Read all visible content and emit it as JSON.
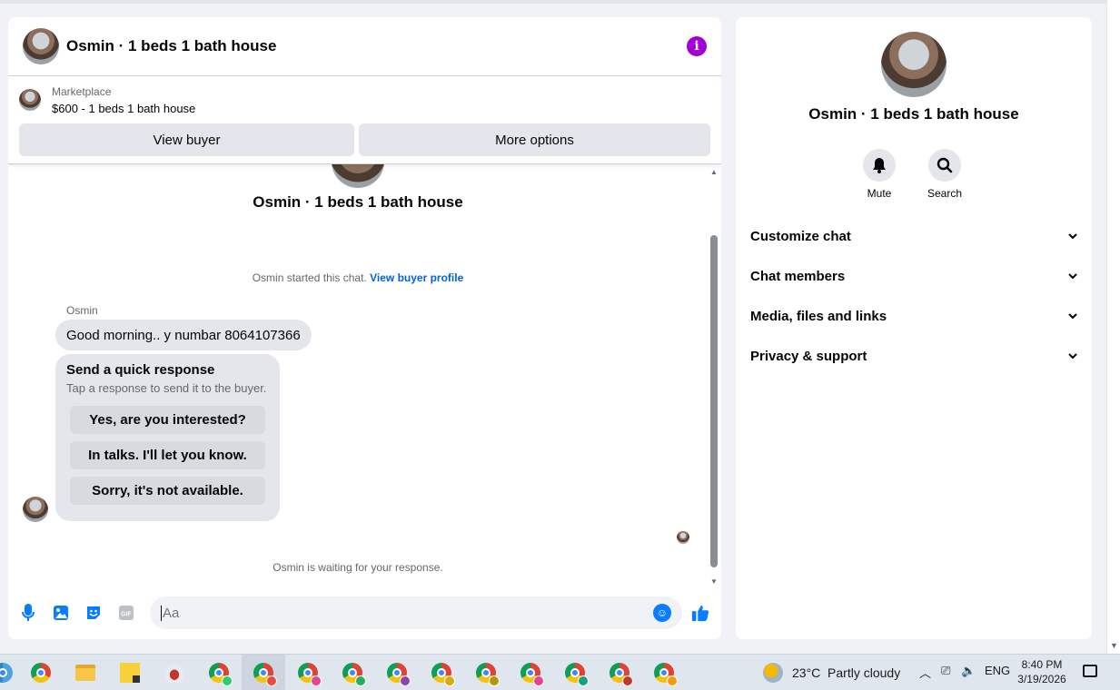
{
  "header": {
    "title": "Osmin · 1 beds 1 bath house",
    "info_icon": "info-icon"
  },
  "listing": {
    "label": "Marketplace",
    "price_title": "$600 - 1 beds 1 bath house",
    "view_buyer": "View buyer",
    "more_options": "More options"
  },
  "thread": {
    "title": "Osmin · 1 beds 1 bath house",
    "started_text": "Osmin started this chat.",
    "view_profile": "View buyer profile",
    "sender": "Osmin",
    "message": "Good morning.. y numbar 8064107366",
    "quick": {
      "title": "Send a quick response",
      "subtitle": "Tap a response to send it to the buyer.",
      "options": [
        "Yes, are you interested?",
        "In talks. I'll let you know.",
        "Sorry, it's not available."
      ]
    },
    "waiting": "Osmin is waiting for your response."
  },
  "composer": {
    "placeholder": "Aa",
    "icons": [
      "mic-icon",
      "image-icon",
      "sticker-icon",
      "gif-icon",
      "emoji-icon",
      "thumbs-up-icon"
    ],
    "gif_label": "GIF"
  },
  "info_panel": {
    "title": "Osmin · 1 beds 1 bath house",
    "mute": "Mute",
    "search": "Search",
    "sections": [
      "Customize chat",
      "Chat members",
      "Media, files and links",
      "Privacy & support"
    ]
  },
  "taskbar": {
    "weather": "23°C  Partly cloudy",
    "lang": "ENG",
    "time": "8:40 PM",
    "date": "3/19/2026"
  },
  "colors": {
    "accent": "#0a7cff",
    "info": "#a200d6",
    "link": "#0064d1",
    "bubble": "#e4e6eb"
  }
}
